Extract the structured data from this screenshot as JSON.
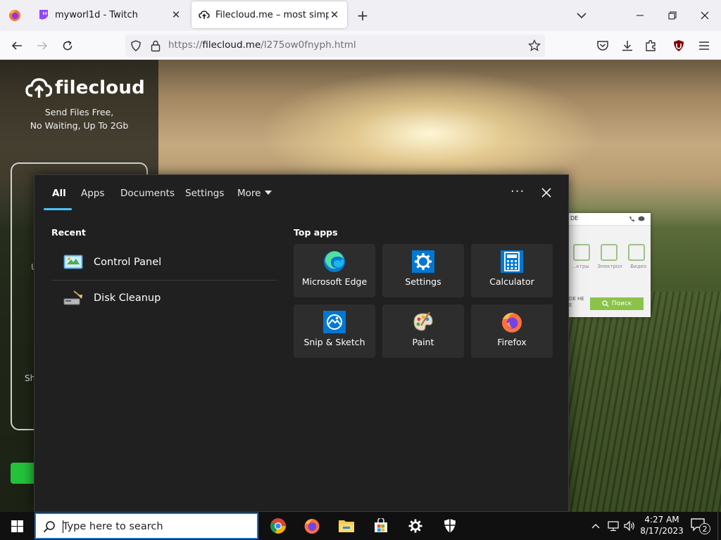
{
  "browser": {
    "tabs": [
      {
        "title": "myworl1d - Twitch",
        "close": "✕"
      },
      {
        "title": "Filecloud.me – most simple file",
        "close": "✕"
      }
    ],
    "new_tab": "+",
    "url_prefix": "https://",
    "url_host": "filecloud.me",
    "url_path": "/l275ow0fnyph.html",
    "extension_badge": "5"
  },
  "filecloud": {
    "logo_text": "filecloud",
    "tagline_1": "Send Files Free,",
    "tagline_2": "No Waiting, Up To 2Gb",
    "fragment_1": "U",
    "fragment_2": "Sh"
  },
  "bg_widget": {
    "header_text": "DE",
    "labels": [
      "...ктры",
      "Электрол",
      "Видео"
    ],
    "side_text_1": "DE НЕ",
    "side_text_2": "E",
    "search_button": "Поиск"
  },
  "search_panel": {
    "tabs": [
      "All",
      "Apps",
      "Documents",
      "Settings",
      "More"
    ],
    "dots": "···",
    "recent_heading": "Recent",
    "recent": [
      {
        "label": "Control Panel"
      },
      {
        "label": "Disk Cleanup"
      }
    ],
    "top_apps_heading": "Top apps",
    "top_apps": [
      {
        "label": "Microsoft Edge"
      },
      {
        "label": "Settings"
      },
      {
        "label": "Calculator"
      },
      {
        "label": "Snip & Sketch"
      },
      {
        "label": "Paint"
      },
      {
        "label": "Firefox"
      }
    ]
  },
  "taskbar": {
    "search_placeholder": "Type here to search",
    "time": "4:27 AM",
    "date": "8/17/2023",
    "notification_count": "2"
  }
}
